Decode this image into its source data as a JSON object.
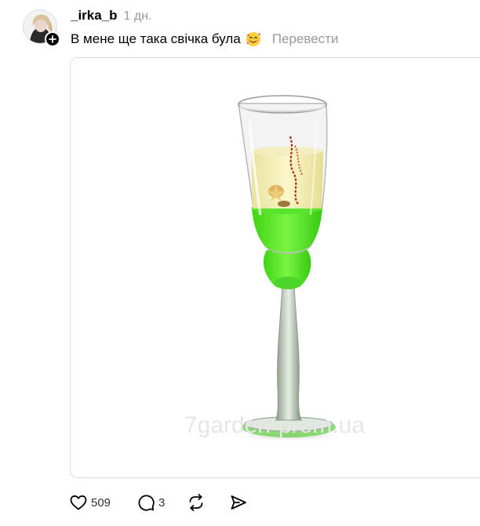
{
  "post": {
    "username": "_irka_b",
    "timestamp": "1 дн.",
    "caption": "В мене ще така свічка була",
    "emoji": "smiling-face-with-hearts-icon",
    "translate_label": "Перевести",
    "media": {
      "watermark": "7garden-prom.ua"
    },
    "actions": {
      "like_count": "509",
      "comment_count": "3"
    }
  },
  "colors": {
    "border": "#dbdbdb",
    "muted_text": "#999999",
    "candle_green": "#4ee61c"
  }
}
